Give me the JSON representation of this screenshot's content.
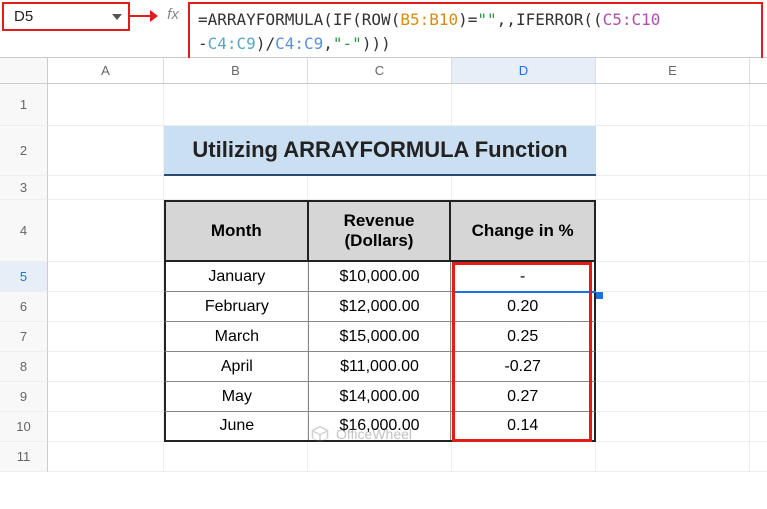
{
  "namebox": {
    "value": "D5"
  },
  "fx_label": "fx",
  "formula": {
    "raw": "=ARRAYFORMULA(IF(ROW(B5:B10)=\"\",,IFERROR((C5:C10-C4:C9)/C4:C9,\"-\")))",
    "seg": {
      "eq": "=",
      "fn1": "ARRAYFORMULA",
      "p1": "(",
      "fn2": "IF",
      "p2": "(",
      "fn3": "ROW",
      "p3": "(",
      "rngB": "B5:B10",
      "p4": ")",
      "eqq": "=",
      "q1": "\"\"",
      "c1": ",,",
      "fn4": "IFERROR",
      "p5": "((",
      "rngC1": "C5:C10",
      "op1": "-",
      "rngC2": "C4:C9",
      "p6": ")",
      "op2": "/",
      "rngC3": "C4:C9",
      "c2": ",",
      "q2": "\"-\"",
      "p7": ")))"
    }
  },
  "columns": {
    "A": "A",
    "B": "B",
    "C": "C",
    "D": "D",
    "E": "E"
  },
  "rows": [
    "1",
    "2",
    "3",
    "4",
    "5",
    "6",
    "7",
    "8",
    "9",
    "10",
    "11"
  ],
  "title": "Utilizing ARRAYFORMULA Function",
  "table": {
    "headers": {
      "b": "Month",
      "c": "Revenue (Dollars)",
      "d": "Change in %"
    },
    "rows": [
      {
        "month": "January",
        "rev": "$10,000.00",
        "chg": "-"
      },
      {
        "month": "February",
        "rev": "$12,000.00",
        "chg": "0.20"
      },
      {
        "month": "March",
        "rev": "$15,000.00",
        "chg": "0.25"
      },
      {
        "month": "April",
        "rev": "$11,000.00",
        "chg": "-0.27"
      },
      {
        "month": "May",
        "rev": "$14,000.00",
        "chg": "0.27"
      },
      {
        "month": "June",
        "rev": "$16,000.00",
        "chg": "0.14"
      }
    ]
  },
  "watermark": "OfficeWheel"
}
